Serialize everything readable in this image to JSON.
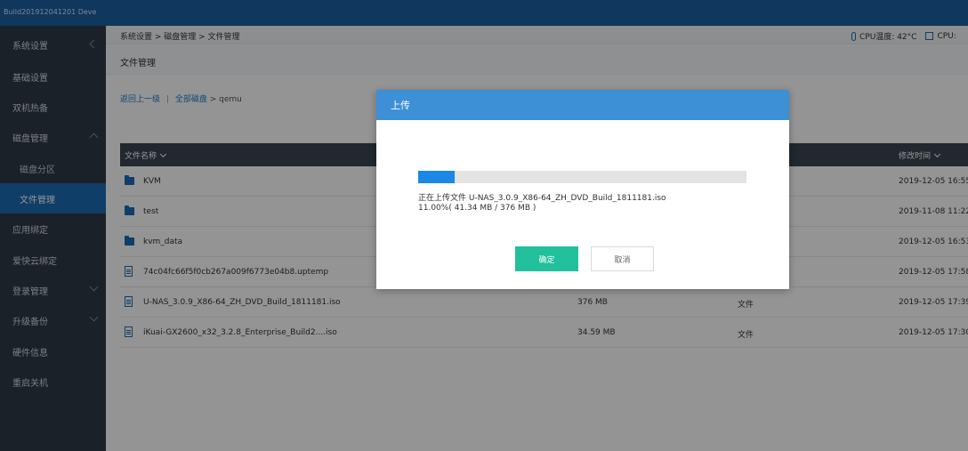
{
  "topbar": {
    "build": "Build201912041201 Deve"
  },
  "sidebar": {
    "items": [
      {
        "label": "系统设置",
        "arrow": "left"
      },
      {
        "label": "基础设置"
      },
      {
        "label": "双机热备"
      },
      {
        "label": "磁盘管理",
        "arrow": "up"
      },
      {
        "label": "磁盘分区",
        "sub": true
      },
      {
        "label": "文件管理",
        "sub": true,
        "active": true
      },
      {
        "label": "应用绑定"
      },
      {
        "label": "爱快云绑定"
      },
      {
        "label": "登录管理",
        "arrow": "down"
      },
      {
        "label": "升级备份",
        "arrow": "down"
      },
      {
        "label": "硬件信息"
      },
      {
        "label": "重启关机"
      }
    ]
  },
  "header": {
    "breadcrumb": "系统设置 > 磁盘管理 > 文件管理",
    "cpu_temp": "CPU温度: 42°C",
    "cpu_usage": "CPU:"
  },
  "page": {
    "title": "文件管理"
  },
  "path_nav": {
    "back": "返回上一级",
    "separator": "|",
    "all_disks": "全部磁盘",
    "arrow": ">",
    "current": "qemu"
  },
  "table": {
    "col_name": "文件名称",
    "col_modified": "修改时间",
    "rows": [
      {
        "kind": "folder",
        "name": "KVM",
        "size": "",
        "type": "",
        "time": "2019-12-05 16:55"
      },
      {
        "kind": "folder",
        "name": "test",
        "size": "",
        "type": "",
        "time": "2019-11-08 11:22"
      },
      {
        "kind": "folder",
        "name": "kvm_data",
        "size": "",
        "type": "",
        "time": "2019-12-05 16:53"
      },
      {
        "kind": "file",
        "name": "74c04fc66f5f0cb267a009f6773e04b8.uptemp",
        "size": "",
        "type": "",
        "time": "2019-12-05 17:58"
      },
      {
        "kind": "file",
        "name": "U-NAS_3.0.9_X86-64_ZH_DVD_Build_1811181.iso",
        "size": "376 MB",
        "type": "文件",
        "time": "2019-12-05 17:39"
      },
      {
        "kind": "file",
        "name": "iKuai-GX2600_x32_3.2.8_Enterprise_Build2....iso",
        "size": "34.59 MB",
        "type": "文件",
        "time": "2019-12-05 17:30"
      }
    ]
  },
  "dialog": {
    "title": "上传",
    "progress_fraction": 0.11,
    "file_line": "正在上传文件 U-NAS_3.0.9_X86-64_ZH_DVD_Build_1811181.iso",
    "progress_line": "11.00%( 41.34 MB / 376 MB )",
    "ok_label": "确定",
    "cancel_label": "取消"
  },
  "colors": {
    "accent": "#1b6bb5",
    "dialog_header": "#3d8fd6",
    "progress": "#1b87e6",
    "ok_button": "#22c09c"
  }
}
